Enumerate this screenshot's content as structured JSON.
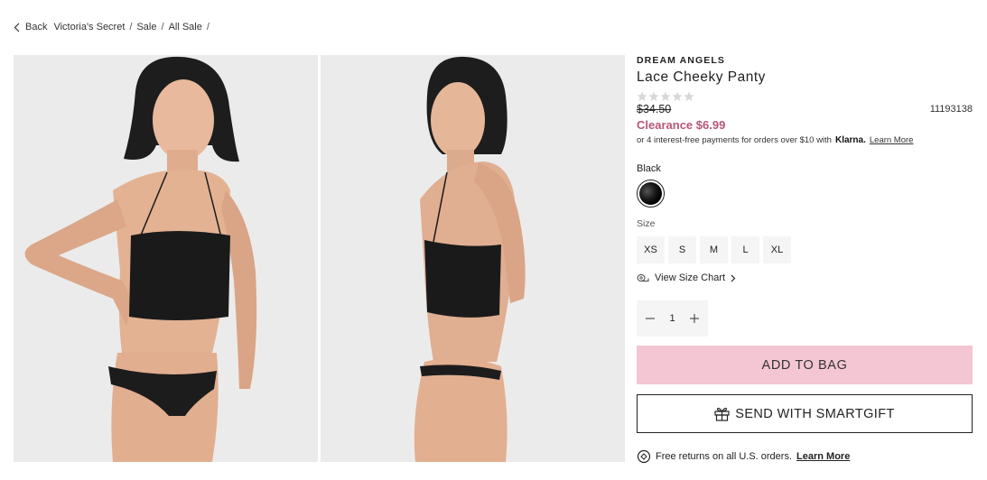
{
  "breadcrumb": {
    "back_label": "Back",
    "items": [
      "Victoria's Secret",
      "Sale",
      "All Sale"
    ],
    "separator": "/"
  },
  "gallery": {
    "images": [
      {
        "alt": "Model front view"
      },
      {
        "alt": "Model back view"
      }
    ]
  },
  "product": {
    "brand": "DREAM ANGELS",
    "title": "Lace Cheeky Panty",
    "rating": 0,
    "rating_max": 5,
    "old_price": "$34.50",
    "sku": "11193138",
    "clearance_price": "Clearance $6.99",
    "klarna_text": "or 4 interest-free payments for orders over $10 with",
    "klarna_brand": "Klarna.",
    "klarna_learn": "Learn More",
    "color_label": "Black",
    "size_label": "Size",
    "sizes": [
      "XS",
      "S",
      "M",
      "L",
      "XL"
    ],
    "size_chart_label": "View Size Chart",
    "quantity": "1",
    "add_to_bag": "ADD TO BAG",
    "smartgift": "SEND WITH SMARTGIFT",
    "returns_text": "Free returns on all U.S. orders.",
    "returns_learn": "Learn More"
  },
  "colors": {
    "clearance": "#b85578",
    "add_to_bag_bg": "#f4c6d3",
    "star_empty": "#d8d8d8",
    "image_bg": "#ebebeb"
  }
}
